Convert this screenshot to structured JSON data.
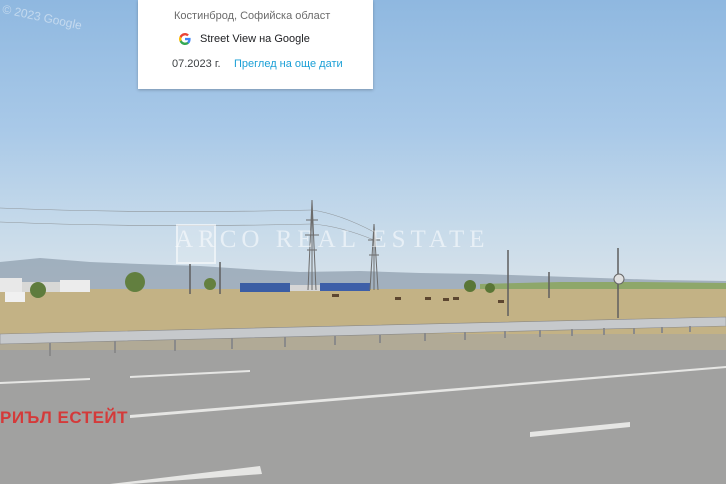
{
  "info_card": {
    "location": "Костинброд, Софийска област",
    "service": "Street View на Google",
    "date": "07.2023 г.",
    "more_link": "Преглед на още дати"
  },
  "copyright": "© 2023 Google",
  "watermark": "ARCO REAL ESTATE",
  "brand_text": "РИЪЛ ЕСТЕЙТ",
  "icons": {
    "google": "google-g-icon"
  },
  "colors": {
    "link": "#1a9fd6",
    "brand": "#d43a3a"
  }
}
